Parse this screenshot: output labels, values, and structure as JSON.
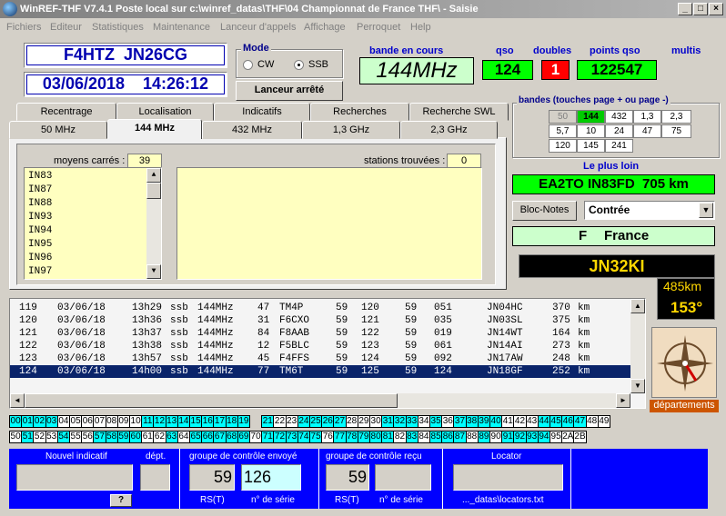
{
  "window": {
    "title": "WinREF-THF V7.4.1 Poste local sur c:\\winref_datas\\THF\\04 Championnat de France THF\\  -  Saisie"
  },
  "menu": [
    "Fichiers",
    "Editeur",
    "Statistiques",
    "Maintenance",
    "Lanceur d'appels",
    "Affichage",
    "Perroquet",
    "Help"
  ],
  "station": {
    "callsign_locator": "F4HTZ  JN26CG",
    "datetime": "03/06/2018    14:26:12"
  },
  "mode": {
    "label": "Mode",
    "cw": "CW",
    "ssb": "SSB",
    "selected": "SSB"
  },
  "lanceur_button": "Lanceur arrêté",
  "bande": {
    "label": "bande en cours",
    "value": "144MHz"
  },
  "qso": {
    "label": "qso",
    "value": "124"
  },
  "doubles": {
    "label": "doubles",
    "value": "1"
  },
  "points": {
    "label": "points qso",
    "value": "122547"
  },
  "multis": {
    "label": "multis"
  },
  "bandes_group": {
    "title": "bandes (touches page + ou page -)",
    "cells": [
      "50",
      "144",
      "432",
      "1,3",
      "2,3",
      "5,7",
      "10",
      "24",
      "47",
      "75",
      "120",
      "145",
      "241"
    ]
  },
  "plus_loin": {
    "label": "Le plus loin",
    "value": "EA2TO IN83FD  705 km"
  },
  "bloc_notes": "Bloc-Notes",
  "contree_select": "Contrée",
  "country": {
    "prefix": "F",
    "name": "France"
  },
  "locator_display": {
    "locator": "JN32KI",
    "distance": "485km",
    "bearing": "153°"
  },
  "departements_label": "départements",
  "tabs_top": [
    "Recentrage",
    "Localisation",
    "Indicatifs",
    "Recherches",
    "Recherche SWL"
  ],
  "tabs_band": [
    "50 MHz",
    "144 MHz",
    "432 MHz",
    "1,3 GHz",
    "2,3 GHz"
  ],
  "active_band_tab": "144 MHz",
  "moyens": {
    "label": "moyens carrés :",
    "count": "39",
    "items": [
      "IN83",
      "IN87",
      "IN88",
      "IN93",
      "IN94",
      "IN95",
      "IN96",
      "IN97"
    ]
  },
  "stations": {
    "label": "stations trouvées :",
    "count": "0"
  },
  "log": [
    [
      "119",
      "03/06/18",
      "13h29",
      "ssb",
      "144MHz",
      "47",
      "TM4P",
      "59",
      "120",
      "59",
      "051",
      "JN04HC",
      "370",
      "km"
    ],
    [
      "120",
      "03/06/18",
      "13h36",
      "ssb",
      "144MHz",
      "31",
      "F6CXO",
      "59",
      "121",
      "59",
      "035",
      "JN03SL",
      "375",
      "km"
    ],
    [
      "121",
      "03/06/18",
      "13h37",
      "ssb",
      "144MHz",
      "84",
      "F8AAB",
      "59",
      "122",
      "59",
      "019",
      "JN14WT",
      "164",
      "km"
    ],
    [
      "122",
      "03/06/18",
      "13h38",
      "ssb",
      "144MHz",
      "12",
      "F5BLC",
      "59",
      "123",
      "59",
      "061",
      "JN14AI",
      "273",
      "km"
    ],
    [
      "123",
      "03/06/18",
      "13h57",
      "ssb",
      "144MHz",
      "45",
      "F4FFS",
      "59",
      "124",
      "59",
      "092",
      "JN17AW",
      "248",
      "km"
    ],
    [
      "124",
      "03/06/18",
      "14h00",
      "ssb",
      "144MHz",
      "77",
      "TM6T",
      "59",
      "125",
      "59",
      "124",
      "JN18GF",
      "252",
      "km"
    ]
  ],
  "departements_row1": [
    "00",
    "01",
    "02",
    "03",
    "04",
    "05",
    "06",
    "07",
    "08",
    "09",
    "10",
    "11",
    "12",
    "13",
    "14",
    "15",
    "16",
    "17",
    "18",
    "19",
    "",
    "21",
    "22",
    "23",
    "24",
    "25",
    "26",
    "27",
    "28",
    "29",
    "30",
    "31",
    "32",
    "33",
    "34",
    "35",
    "36",
    "37",
    "38",
    "39",
    "40",
    "41",
    "42",
    "43",
    "44",
    "45",
    "46",
    "47",
    "48",
    "49"
  ],
  "departements_row1_cyan": [
    "00",
    "01",
    "02",
    "03",
    "11",
    "12",
    "13",
    "14",
    "15",
    "16",
    "17",
    "18",
    "19",
    "21",
    "24",
    "25",
    "26",
    "27",
    "31",
    "32",
    "33",
    "35",
    "37",
    "38",
    "39",
    "40",
    "44",
    "45",
    "46",
    "47"
  ],
  "departements_row2": [
    "50",
    "51",
    "52",
    "53",
    "54",
    "55",
    "56",
    "57",
    "58",
    "59",
    "60",
    "61",
    "62",
    "63",
    "64",
    "65",
    "66",
    "67",
    "68",
    "69",
    "70",
    "71",
    "72",
    "73",
    "74",
    "75",
    "76",
    "77",
    "78",
    "79",
    "80",
    "81",
    "82",
    "83",
    "84",
    "85",
    "86",
    "87",
    "88",
    "89",
    "90",
    "91",
    "92",
    "93",
    "94",
    "95",
    "2A",
    "2B"
  ],
  "departements_row2_cyan": [
    "51",
    "54",
    "57",
    "58",
    "59",
    "60",
    "63",
    "65",
    "66",
    "67",
    "68",
    "69",
    "71",
    "72",
    "73",
    "74",
    "75",
    "77",
    "78",
    "79",
    "80",
    "81",
    "83",
    "85",
    "86",
    "87",
    "89",
    "91",
    "92",
    "93",
    "94"
  ],
  "bottom": {
    "nouvel_indicatif": "Nouvel indicatif",
    "dept": "dépt.",
    "help_button": "?",
    "envoye": {
      "title": "groupe de contrôle envoyé",
      "rst": "59",
      "serie": "126",
      "rst_label": "RS(T)",
      "serie_label": "n° de série"
    },
    "recu": {
      "title": "groupe de contrôle reçu",
      "rst": "59",
      "serie": "",
      "rst_label": "RS(T)",
      "serie_label": "n° de série"
    },
    "locator": {
      "title": "Locator",
      "file": "..._datas\\locators.txt"
    }
  },
  "colors": {
    "green": "#00ff00",
    "red": "#ff0000",
    "blue": "#0000ff",
    "cyan": "#00ffff",
    "navy": "#0a246a",
    "yellow": "#ffffc0"
  }
}
